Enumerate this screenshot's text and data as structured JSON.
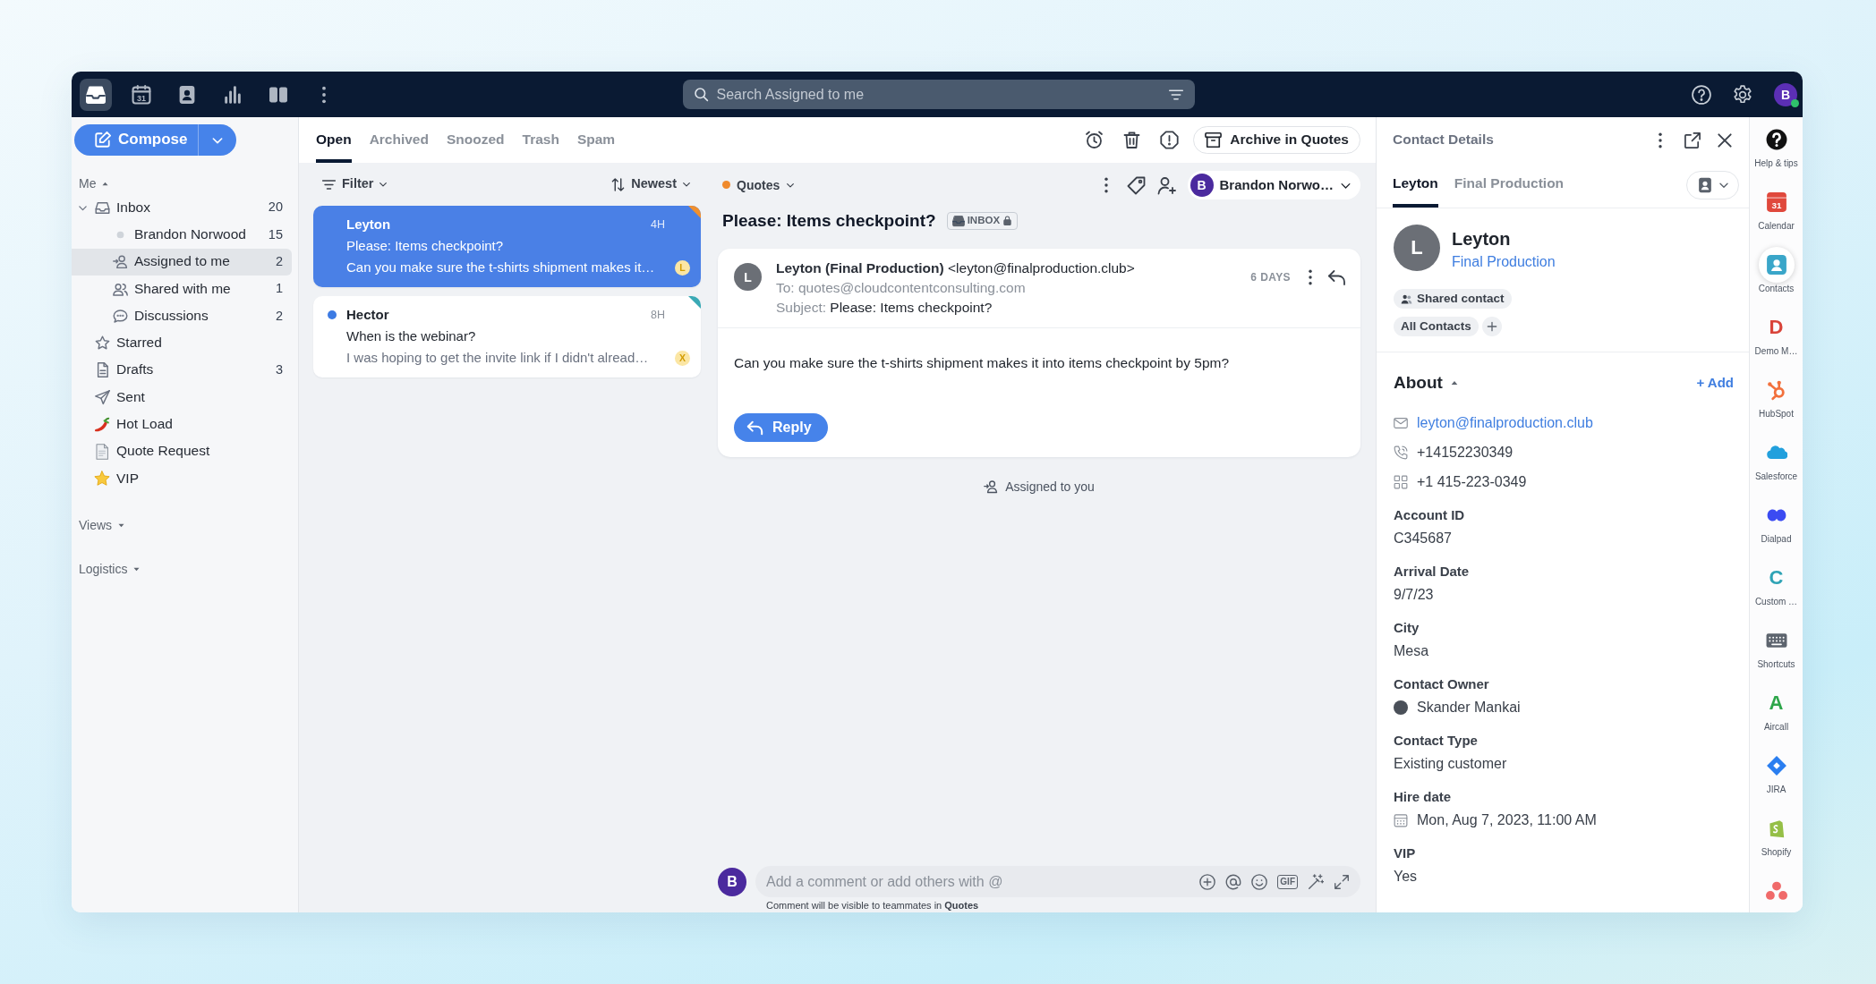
{
  "topbar": {
    "nav": [
      {
        "kind": "inbox",
        "selected": true
      },
      {
        "kind": "calendar",
        "glyph": "31",
        "selected": false
      },
      {
        "kind": "contacts",
        "selected": false
      },
      {
        "kind": "analytics",
        "selected": false
      },
      {
        "kind": "columns",
        "selected": false
      },
      {
        "kind": "more",
        "selected": false
      }
    ],
    "search": {
      "placeholder": "Search Assigned to me"
    },
    "user": {
      "initial": "B",
      "online": true
    }
  },
  "sidebar": {
    "compose": "Compose",
    "sections": [
      {
        "label": "Me",
        "expanded": true,
        "items": [
          {
            "label": "Inbox",
            "kind": "inbox",
            "count": "20",
            "expanded": true,
            "selected": false,
            "children": [
              {
                "label": "Brandon Norwood",
                "kind": "teammate",
                "count": "15",
                "selected": false
              },
              {
                "label": "Assigned to me",
                "kind": "assigned",
                "count": "2",
                "selected": true
              },
              {
                "label": "Shared with me",
                "kind": "shared",
                "count": "1",
                "selected": false
              },
              {
                "label": "Discussions",
                "kind": "discussions",
                "count": "2",
                "selected": false
              }
            ]
          },
          {
            "label": "Starred",
            "kind": "starred",
            "selected": false
          },
          {
            "label": "Drafts",
            "kind": "drafts",
            "count": "3",
            "selected": false
          },
          {
            "label": "Sent",
            "kind": "sent",
            "selected": false
          },
          {
            "label": "Hot Load",
            "kind": "chili",
            "selected": false
          },
          {
            "label": "Quote Request",
            "kind": "memo",
            "selected": false
          },
          {
            "label": "VIP",
            "kind": "goldstar",
            "selected": false
          }
        ]
      },
      {
        "label": "Views",
        "expanded": false
      },
      {
        "label": "Logistics",
        "expanded": false
      }
    ]
  },
  "mailbox": {
    "tabs": [
      {
        "label": "Open",
        "selected": true
      },
      {
        "label": "Archived",
        "selected": false
      },
      {
        "label": "Snoozed",
        "selected": false
      },
      {
        "label": "Trash",
        "selected": false
      },
      {
        "label": "Spam",
        "selected": false
      }
    ],
    "archive_button": "Archive in Quotes",
    "filter": "Filter",
    "sort": "Newest",
    "messages": [
      {
        "sender": "Leyton",
        "time": "4H",
        "subject": "Please: Items checkpoint?",
        "preview": "Can you make sure the t-shirts shipment makes it…",
        "assignee": "L",
        "color": "#f0902f",
        "unread": false,
        "selected": true
      },
      {
        "sender": "Hector",
        "time": "8H",
        "subject": "When is the webinar?",
        "preview": "I was hoping to get the invite link if I didn't alread…",
        "assignee": "X",
        "color": "#3aa9b5",
        "unread": true,
        "selected": false
      }
    ]
  },
  "conversation": {
    "inbox": "Quotes",
    "assignee": {
      "initial": "B",
      "name": "Brandon Norwo…"
    },
    "subject": "Please: Items checkpoint?",
    "badge": "INBOX",
    "message": {
      "initial": "L",
      "from": "Leyton (Final Production)",
      "address": "<leyton@finalproduction.club>",
      "to": "To: quotes@cloudcontentconsulting.com",
      "subject_label": "Subject:",
      "subject": "Please: Items checkpoint?",
      "age": "6 DAYS",
      "body": "Can you make sure the t-shirts shipment makes it into items checkpoint by 5pm?",
      "reply": "Reply"
    },
    "activity": "Assigned to you",
    "composer": {
      "initial": "B",
      "placeholder": "Add a comment or add others with @",
      "tools": [
        {
          "kind": "add"
        },
        {
          "kind": "mention"
        },
        {
          "kind": "emoji"
        },
        {
          "kind": "gif",
          "glyph": "GIF"
        },
        {
          "kind": "magic"
        },
        {
          "kind": "expand"
        }
      ],
      "hint": "Comment will be visible to teammates in **Quotes**"
    }
  },
  "contact_panel": {
    "title": "Contact Details",
    "tabs": [
      {
        "label": "Leyton",
        "selected": true
      },
      {
        "label": "Final Production",
        "selected": false
      }
    ],
    "contact": {
      "initial": "L",
      "name": "Leyton",
      "company": "Final Production",
      "shared": "Shared contact",
      "lists": [
        "All Contacts"
      ]
    },
    "about": {
      "title": "About",
      "expanded": true,
      "add": "+ Add",
      "methods": [
        {
          "kind": "email",
          "value": "leyton@finalproduction.club"
        },
        {
          "kind": "phone",
          "value": "+14152230349"
        },
        {
          "kind": "other",
          "value": "+1 415-223-0349"
        }
      ],
      "fields": [
        {
          "label": "Account ID",
          "value": "C345687",
          "kind": "text"
        },
        {
          "label": "Arrival Date",
          "value": "9/7/23",
          "kind": "text"
        },
        {
          "label": "City",
          "value": "Mesa",
          "kind": "text"
        },
        {
          "label": "Contact Owner",
          "value": "Skander Mankai",
          "kind": "person"
        },
        {
          "label": "Contact Type",
          "value": "Existing customer",
          "kind": "text"
        },
        {
          "label": "Hire date",
          "value": "Mon, Aug 7, 2023, 11:00 AM",
          "kind": "date"
        },
        {
          "label": "VIP",
          "value": "Yes",
          "kind": "text"
        }
      ]
    }
  },
  "rail": [
    {
      "label": "Help & tips",
      "kind": "help",
      "selected": false
    },
    {
      "label": "Calendar",
      "kind": "calendar",
      "glyph": "31",
      "selected": false
    },
    {
      "label": "Contacts",
      "kind": "contacts",
      "selected": true
    },
    {
      "label": "Demo M…",
      "kind": "letter",
      "glyph": "D",
      "color": "#d9443a",
      "selected": false
    },
    {
      "label": "HubSpot",
      "kind": "sprocket",
      "selected": false
    },
    {
      "label": "Salesforce",
      "kind": "cloud",
      "selected": false
    },
    {
      "label": "Dialpad",
      "kind": "blob",
      "selected": false
    },
    {
      "label": "Custom …",
      "kind": "letter",
      "glyph": "C",
      "color": "#2fa3b5",
      "selected": false
    },
    {
      "label": "Shortcuts",
      "kind": "keyboard",
      "selected": false
    },
    {
      "label": "Aircall",
      "kind": "letter",
      "glyph": "A",
      "color": "#2ea64a",
      "selected": false
    },
    {
      "label": "JIRA",
      "kind": "diamond",
      "selected": false
    },
    {
      "label": "Shopify",
      "kind": "bag",
      "selected": false
    },
    {
      "kind": "dots",
      "selected": false
    }
  ]
}
